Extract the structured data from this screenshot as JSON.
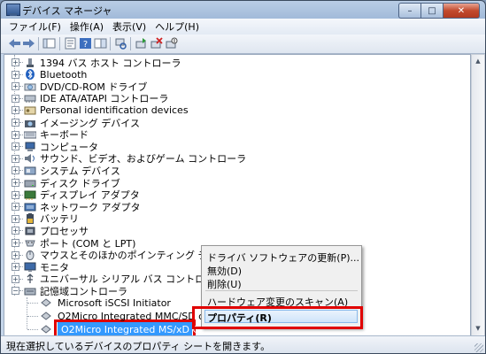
{
  "window": {
    "title": "デバイス マネージャ",
    "min": "–",
    "max": "□",
    "close": "✕"
  },
  "menu": [
    "ファイル(F)",
    "操作(A)",
    "表示(V)",
    "ヘルプ(H)"
  ],
  "tree": [
    {
      "label": "1394 バス ホスト コントローラ",
      "icon": "firewire-icon",
      "expanded": false
    },
    {
      "label": "Bluetooth",
      "icon": "bluetooth-icon",
      "expanded": false
    },
    {
      "label": "DVD/CD-ROM ドライブ",
      "icon": "cdrom-icon",
      "expanded": false
    },
    {
      "label": "IDE ATA/ATAPI コントローラ",
      "icon": "ide-icon",
      "expanded": false
    },
    {
      "label": "Personal identification devices",
      "icon": "id-device-icon",
      "expanded": false
    },
    {
      "label": "イメージング デバイス",
      "icon": "camera-icon",
      "expanded": false
    },
    {
      "label": "キーボード",
      "icon": "keyboard-icon",
      "expanded": false
    },
    {
      "label": "コンピュータ",
      "icon": "computer-icon",
      "expanded": false
    },
    {
      "label": "サウンド、ビデオ、およびゲーム コントローラ",
      "icon": "sound-icon",
      "expanded": false
    },
    {
      "label": "システム デバイス",
      "icon": "system-device-icon",
      "expanded": false
    },
    {
      "label": "ディスク ドライブ",
      "icon": "disk-drive-icon",
      "expanded": false
    },
    {
      "label": "ディスプレイ アダプタ",
      "icon": "display-adapter-icon",
      "expanded": false
    },
    {
      "label": "ネットワーク アダプタ",
      "icon": "network-adapter-icon",
      "expanded": false
    },
    {
      "label": "バッテリ",
      "icon": "battery-icon",
      "expanded": false
    },
    {
      "label": "プロセッサ",
      "icon": "processor-icon",
      "expanded": false
    },
    {
      "label": "ポート (COM と LPT)",
      "icon": "port-icon",
      "expanded": false
    },
    {
      "label": "マウスとそのほかのポインティング デバイス",
      "icon": "mouse-icon",
      "expanded": false
    },
    {
      "label": "モニタ",
      "icon": "monitor-icon",
      "expanded": false
    },
    {
      "label": "ユニバーサル シリアル バス コントローラ",
      "icon": "usb-icon",
      "expanded": false
    },
    {
      "label": "記憶域コントローラ",
      "icon": "storage-controller-icon",
      "expanded": true
    }
  ],
  "children": [
    {
      "label": "Microsoft iSCSI Initiator"
    },
    {
      "label": "O2Micro Integrated MMC/SD controlle"
    },
    {
      "label": "O2Micro Integrated MS/xD Controller"
    }
  ],
  "context_menu": {
    "update": "ドライバ ソフトウェアの更新(P)...",
    "disable": "無効(D)",
    "uninstall": "削除(U)",
    "scan": "ハードウェア変更のスキャン(A)",
    "properties": "プロパティ(R)"
  },
  "status": "現在選択しているデバイスのプロパティ シートを開きます。",
  "colors": {
    "selection": "#3399ff",
    "callout": "#e00000"
  }
}
